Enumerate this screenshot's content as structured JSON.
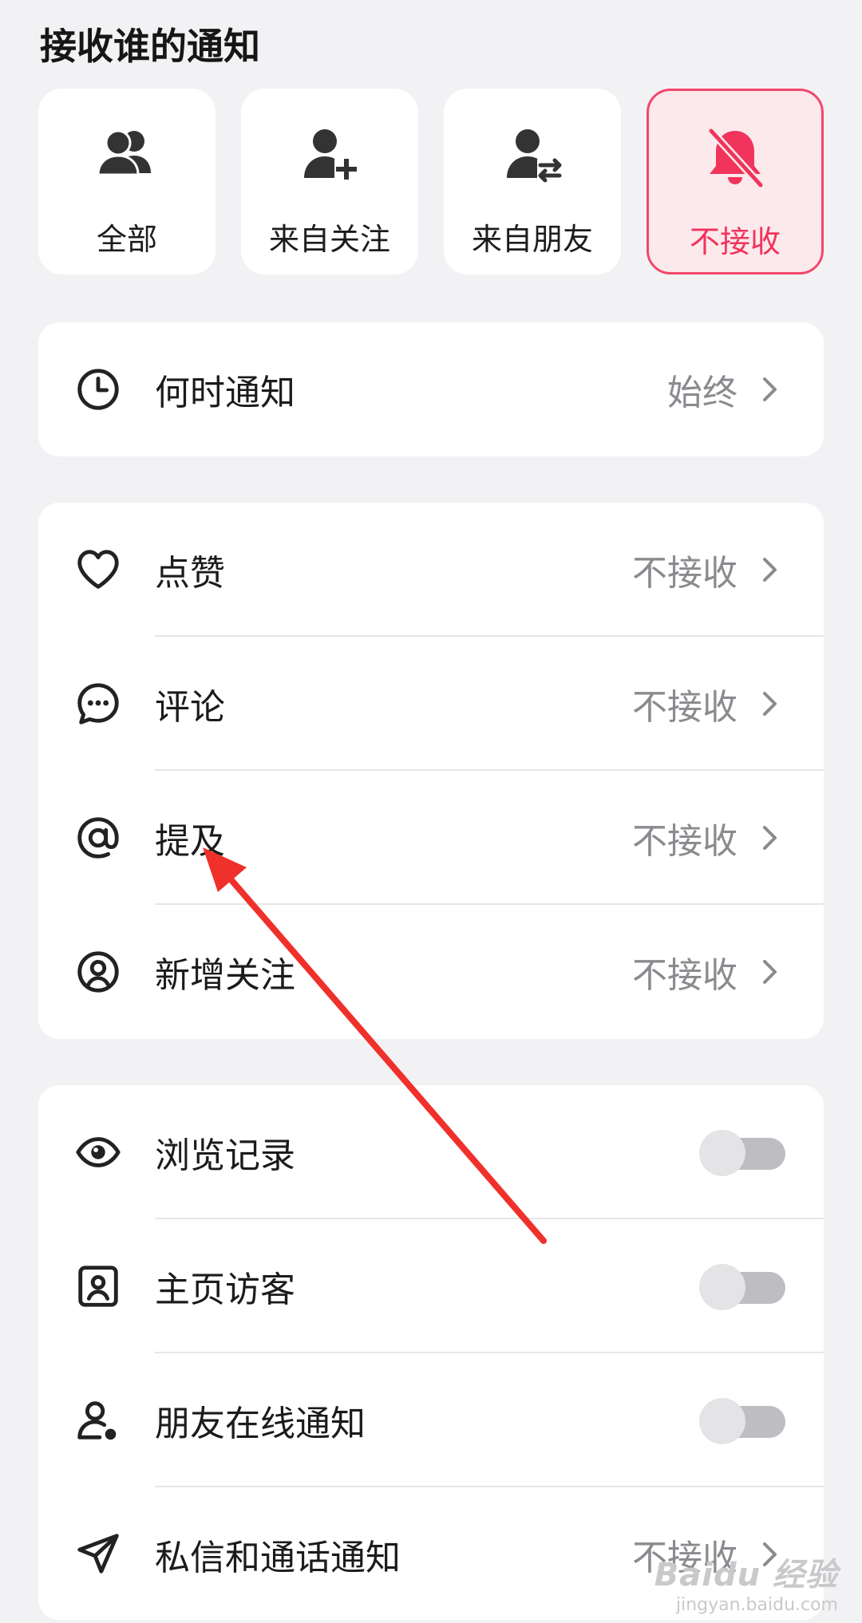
{
  "section_title": "接收谁的通知",
  "options": [
    {
      "label": "全部",
      "icon": "group-icon",
      "selected": false
    },
    {
      "label": "来自关注",
      "icon": "person-add-icon",
      "selected": false
    },
    {
      "label": "来自朋友",
      "icon": "person-swap-icon",
      "selected": false
    },
    {
      "label": "不接收",
      "icon": "bell-off-icon",
      "selected": true
    }
  ],
  "when": {
    "label": "何时通知",
    "value": "始终",
    "icon": "clock-icon"
  },
  "notify_types": [
    {
      "label": "点赞",
      "value": "不接收",
      "icon": "heart-icon"
    },
    {
      "label": "评论",
      "value": "不接收",
      "icon": "comment-icon"
    },
    {
      "label": "提及",
      "value": "不接收",
      "icon": "at-icon"
    },
    {
      "label": "新增关注",
      "value": "不接收",
      "icon": "user-circle-icon"
    }
  ],
  "toggles": [
    {
      "label": "浏览记录",
      "icon": "eye-icon",
      "on": false
    },
    {
      "label": "主页访客",
      "icon": "profile-card-icon",
      "on": false
    },
    {
      "label": "朋友在线通知",
      "icon": "person-online-icon",
      "on": false
    }
  ],
  "dm": {
    "label": "私信和通话通知",
    "value": "不接收",
    "icon": "send-icon"
  },
  "watermark": {
    "brand": "Baidu 经验",
    "url": "jingyan.baidu.com"
  },
  "colors": {
    "accent": "#f0345b",
    "background": "#f2f2f4",
    "annotation_arrow": "#f0302a"
  }
}
